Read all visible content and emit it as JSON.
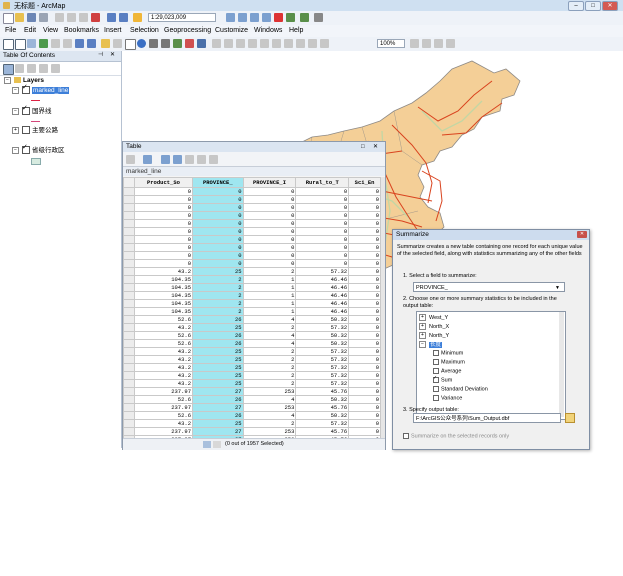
{
  "window": {
    "title": "无标题 - ArcMap"
  },
  "toolbar": {
    "scale_value": "1:29,023,009"
  },
  "menu": [
    "File",
    "Edit",
    "View",
    "Bookmarks",
    "Insert",
    "Selection",
    "Geoprocessing",
    "Customize",
    "Windows",
    "Help"
  ],
  "tools": {
    "zoom_percent": "100%"
  },
  "toc": {
    "title": "Table Of Contents",
    "layers_label": "Layers",
    "items": [
      {
        "label": "marked_line",
        "checked": true,
        "highlighted": true
      },
      {
        "label": "国界线",
        "checked": true
      },
      {
        "label": "主要公路",
        "checked": false
      },
      {
        "label": "省级行政区",
        "checked": true
      }
    ]
  },
  "table_window": {
    "title": "Table",
    "tab_label": "marked_line",
    "columns": [
      "",
      "Product_So",
      "PROVINCE_",
      "PROVINCE_I",
      "Rural_to_T",
      "Sci_En"
    ],
    "rows": [
      [
        "0",
        "0",
        "0",
        "0",
        "0"
      ],
      [
        "0",
        "0",
        "0",
        "0",
        "0"
      ],
      [
        "0",
        "0",
        "0",
        "0",
        "0"
      ],
      [
        "0",
        "0",
        "0",
        "0",
        "0"
      ],
      [
        "0",
        "0",
        "0",
        "0",
        "0"
      ],
      [
        "0",
        "0",
        "0",
        "0",
        "0"
      ],
      [
        "0",
        "0",
        "0",
        "0",
        "0"
      ],
      [
        "0",
        "0",
        "0",
        "0",
        "0"
      ],
      [
        "0",
        "0",
        "0",
        "0",
        "0"
      ],
      [
        "0",
        "0",
        "0",
        "0",
        "0"
      ],
      [
        "43.2",
        "25",
        "2",
        "57.32",
        "0"
      ],
      [
        "104.35",
        "2",
        "1",
        "46.46",
        "0"
      ],
      [
        "104.35",
        "2",
        "1",
        "46.46",
        "0"
      ],
      [
        "104.35",
        "2",
        "1",
        "46.46",
        "0"
      ],
      [
        "104.35",
        "2",
        "1",
        "46.46",
        "0"
      ],
      [
        "104.35",
        "2",
        "1",
        "46.46",
        "0"
      ],
      [
        "52.6",
        "26",
        "4",
        "50.32",
        "0"
      ],
      [
        "43.2",
        "25",
        "2",
        "57.32",
        "0"
      ],
      [
        "52.6",
        "26",
        "4",
        "50.32",
        "0"
      ],
      [
        "52.6",
        "26",
        "4",
        "50.32",
        "0"
      ],
      [
        "43.2",
        "25",
        "2",
        "57.32",
        "0"
      ],
      [
        "43.2",
        "25",
        "2",
        "57.32",
        "0"
      ],
      [
        "43.2",
        "25",
        "2",
        "57.32",
        "0"
      ],
      [
        "43.2",
        "25",
        "2",
        "57.32",
        "0"
      ],
      [
        "43.2",
        "25",
        "2",
        "57.32",
        "0"
      ],
      [
        "237.97",
        "27",
        "253",
        "45.76",
        "0"
      ],
      [
        "52.6",
        "26",
        "4",
        "50.32",
        "0"
      ],
      [
        "237.97",
        "27",
        "253",
        "45.76",
        "0"
      ],
      [
        "52.6",
        "26",
        "4",
        "50.32",
        "0"
      ],
      [
        "43.2",
        "25",
        "2",
        "57.32",
        "0"
      ],
      [
        "237.97",
        "27",
        "253",
        "45.76",
        "0"
      ],
      [
        "237.97",
        "27",
        "253",
        "45.76",
        "0"
      ]
    ],
    "status_text": "(0 out of 1957 Selected)"
  },
  "summarize_dialog": {
    "title": "Summarize",
    "description": "Summarize creates a new table containing one record for each unique value of the selected field, along with statistics summarizing any of the other fields",
    "step1_label": "1.  Select a field to summarize:",
    "field_value": "PROVINCE_",
    "step2_label": "2.  Choose one or more summary statistics to be included in the output table:",
    "tree": [
      {
        "label": "West_Y",
        "type": "group"
      },
      {
        "label": "North_X",
        "type": "group"
      },
      {
        "label": "North_Y",
        "type": "group"
      },
      {
        "label": "长度",
        "type": "group-open",
        "selected": true
      },
      {
        "label": "Minimum",
        "type": "stat",
        "checked": false
      },
      {
        "label": "Maximum",
        "type": "stat",
        "checked": false
      },
      {
        "label": "Average",
        "type": "stat",
        "checked": false
      },
      {
        "label": "Sum",
        "type": "stat",
        "checked": true
      },
      {
        "label": "Standard Deviation",
        "type": "stat",
        "checked": false
      },
      {
        "label": "Variance",
        "type": "stat",
        "checked": false
      }
    ],
    "step3_label": "3.  Specify output table:",
    "output_path": "F:\\ArcGIS公众号系列\\Sum_Output.dbf",
    "selected_only_label": "Summarize on the selected records only"
  },
  "colors": {
    "map_fill": "#f4cf97",
    "map_stroke": "#8e8a86",
    "road": "#d9431e",
    "road_secondary": "#c2d7a4",
    "selected_column": "#9fe6f0"
  }
}
